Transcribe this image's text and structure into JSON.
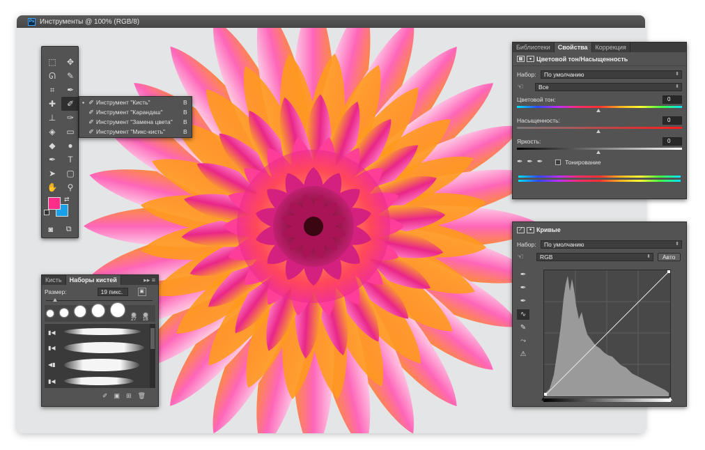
{
  "window": {
    "title": "Инструменты @ 100% (RGB/8)",
    "app_badge": "Ps"
  },
  "toolbox": {
    "tools": [
      {
        "name": "marquee-tool-icon",
        "glyph": "⬚"
      },
      {
        "name": "move-tool-icon",
        "glyph": "✥"
      },
      {
        "name": "lasso-tool-icon",
        "glyph": "ᘏ"
      },
      {
        "name": "quick-select-tool-icon",
        "glyph": "✎"
      },
      {
        "name": "crop-tool-icon",
        "glyph": "⌗"
      },
      {
        "name": "eyedropper-tool-icon",
        "glyph": "✒"
      },
      {
        "name": "healing-tool-icon",
        "glyph": "✚"
      },
      {
        "name": "brush-tool-icon",
        "glyph": "✐"
      },
      {
        "name": "stamp-tool-icon",
        "glyph": "⊥"
      },
      {
        "name": "history-brush-tool-icon",
        "glyph": "✑"
      },
      {
        "name": "eraser-tool-icon",
        "glyph": "◈"
      },
      {
        "name": "gradient-tool-icon",
        "glyph": "▭"
      },
      {
        "name": "blur-tool-icon",
        "glyph": "◆"
      },
      {
        "name": "dodge-tool-icon",
        "glyph": "●"
      },
      {
        "name": "pen-tool-icon",
        "glyph": "✒"
      },
      {
        "name": "type-tool-icon",
        "glyph": "T"
      },
      {
        "name": "path-select-tool-icon",
        "glyph": "➤"
      },
      {
        "name": "shape-tool-icon",
        "glyph": "▢"
      },
      {
        "name": "hand-tool-icon",
        "glyph": "✋"
      },
      {
        "name": "zoom-tool-icon",
        "glyph": "⚲"
      }
    ],
    "foreground_color": "#ff2d8a",
    "background_color": "#1aa0e8"
  },
  "flyout": {
    "items": [
      {
        "label": "Инструмент \"Кисть\"",
        "key": "B",
        "selected": true
      },
      {
        "label": "Инструмент \"Карандаш\"",
        "key": "B",
        "selected": false
      },
      {
        "label": "Инструмент \"Замена цвета\"",
        "key": "B",
        "selected": false
      },
      {
        "label": "Инструмент \"Микс-кисть\"",
        "key": "B",
        "selected": false
      }
    ]
  },
  "brush_panel": {
    "tabs": [
      "Кисть",
      "Наборы кистей"
    ],
    "size_label": "Размер:",
    "size_value": "19 пикс.",
    "tip_numbers": [
      "27",
      "18"
    ]
  },
  "properties": {
    "tabs": [
      "Библиотеки",
      "Свойства",
      "Коррекция"
    ],
    "title": "Цветовой тон/Насыщенность",
    "preset_label": "Набор:",
    "preset_value": "По умолчанию",
    "channel_value": "Все",
    "hue_label": "Цветовой тон:",
    "hue_value": "0",
    "saturation_label": "Насыщенность:",
    "saturation_value": "0",
    "lightness_label": "Яркость:",
    "lightness_value": "0",
    "colorize_label": "Тонирование"
  },
  "curves": {
    "title": "Кривые",
    "preset_label": "Набор:",
    "preset_value": "По умолчанию",
    "channel_value": "RGB",
    "auto_label": "Авто"
  }
}
